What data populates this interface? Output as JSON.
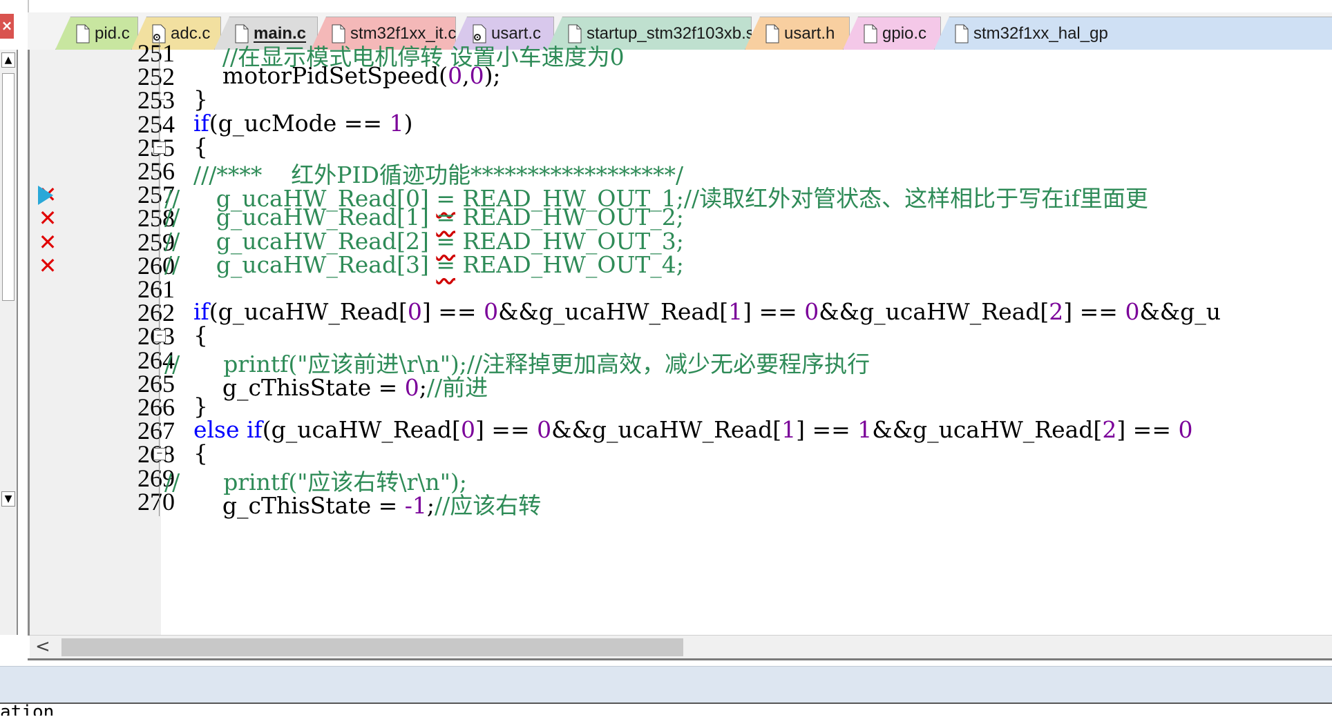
{
  "window": {
    "close_glyph": "×",
    "vscroll_up_glyph": "▲",
    "vscroll_down_glyph": "▼",
    "hscroll_left_glyph": "<"
  },
  "tabs": [
    {
      "label": "pid.c",
      "color": "#c8e6a0",
      "icon": "file-icon",
      "active": false
    },
    {
      "label": "adc.c",
      "color": "#f2e0a0",
      "icon": "file-gear-icon",
      "active": false
    },
    {
      "label": "main.c",
      "color": "#dcdcdc",
      "icon": "file-icon",
      "active": true
    },
    {
      "label": "stm32f1xx_it.c",
      "color": "#f4b8b8",
      "icon": "file-icon",
      "active": false
    },
    {
      "label": "usart.c",
      "color": "#d8c8ec",
      "icon": "file-gear-icon",
      "active": false
    },
    {
      "label": "startup_stm32f103xb.s",
      "color": "#bfe0cf",
      "icon": "file-icon",
      "active": false
    },
    {
      "label": "usart.h",
      "color": "#f8cfa0",
      "icon": "file-icon",
      "active": false
    },
    {
      "label": "gpio.c",
      "color": "#f4c8e8",
      "icon": "file-icon",
      "active": false
    },
    {
      "label": "stm32f1xx_hal_gp",
      "color": "#cfe0f4",
      "icon": "file-icon",
      "active": false
    }
  ],
  "code_lines": [
    {
      "num": "251",
      "marker": "",
      "fold": "line",
      "segments": [
        {
          "t": "        ",
          "c": "c-pl"
        },
        {
          "t": "//在显示模式电机停转 设置小车速度为0",
          "c": "c-com"
        }
      ]
    },
    {
      "num": "252",
      "marker": "",
      "fold": "line",
      "segments": [
        {
          "t": "        motorPidSetSpeed(",
          "c": "c-pl"
        },
        {
          "t": "0",
          "c": "c-num"
        },
        {
          "t": ",",
          "c": "c-pl"
        },
        {
          "t": "0",
          "c": "c-num"
        },
        {
          "t": ");",
          "c": "c-pl"
        }
      ]
    },
    {
      "num": "253",
      "marker": "",
      "fold": "end",
      "segments": [
        {
          "t": "    }",
          "c": "c-pl"
        }
      ]
    },
    {
      "num": "254",
      "marker": "",
      "fold": "line",
      "segments": [
        {
          "t": "    ",
          "c": "c-pl"
        },
        {
          "t": "if",
          "c": "c-kw"
        },
        {
          "t": "(g_ucMode == ",
          "c": "c-pl"
        },
        {
          "t": "1",
          "c": "c-num"
        },
        {
          "t": ")",
          "c": "c-pl"
        }
      ]
    },
    {
      "num": "255",
      "marker": "",
      "fold": "box",
      "segments": [
        {
          "t": "    {",
          "c": "c-pl"
        }
      ]
    },
    {
      "num": "256",
      "marker": "",
      "fold": "line",
      "segments": [
        {
          "t": "    ",
          "c": "c-pl"
        },
        {
          "t": "///****    红外PID循迹功能******************/",
          "c": "c-com"
        }
      ]
    },
    {
      "num": "257",
      "marker": "first",
      "fold": "line",
      "segments": [
        {
          "t": "// ",
          "c": "c-com"
        },
        {
          "t": "    g_ucaHW_Read[0] ",
          "c": "c-com"
        },
        {
          "t": "=",
          "c": "c-com sq"
        },
        {
          "t": " READ_HW_OUT_1;//读取红外对管状态、这样相比于写在if里面更",
          "c": "c-com"
        }
      ]
    },
    {
      "num": "258",
      "marker": "x",
      "fold": "line",
      "segments": [
        {
          "t": "// ",
          "c": "c-com"
        },
        {
          "t": "    g_ucaHW_Read[1] ",
          "c": "c-com"
        },
        {
          "t": "=",
          "c": "c-com sq"
        },
        {
          "t": " READ_HW_OUT_2;",
          "c": "c-com"
        }
      ]
    },
    {
      "num": "259",
      "marker": "x",
      "fold": "line",
      "segments": [
        {
          "t": "// ",
          "c": "c-com"
        },
        {
          "t": "    g_ucaHW_Read[2] ",
          "c": "c-com"
        },
        {
          "t": "=",
          "c": "c-com sq"
        },
        {
          "t": " READ_HW_OUT_3;",
          "c": "c-com"
        }
      ]
    },
    {
      "num": "260",
      "marker": "x",
      "fold": "line",
      "segments": [
        {
          "t": "// ",
          "c": "c-com"
        },
        {
          "t": "    g_ucaHW_Read[3] ",
          "c": "c-com"
        },
        {
          "t": "=",
          "c": "c-com sq"
        },
        {
          "t": " READ_HW_OUT_4;",
          "c": "c-com"
        }
      ]
    },
    {
      "num": "261",
      "marker": "",
      "fold": "line",
      "segments": [
        {
          "t": "",
          "c": "c-pl"
        }
      ]
    },
    {
      "num": "262",
      "marker": "",
      "fold": "line",
      "segments": [
        {
          "t": "    ",
          "c": "c-pl"
        },
        {
          "t": "if",
          "c": "c-kw"
        },
        {
          "t": "(g_ucaHW_Read[",
          "c": "c-pl"
        },
        {
          "t": "0",
          "c": "c-num"
        },
        {
          "t": "] == ",
          "c": "c-pl"
        },
        {
          "t": "0",
          "c": "c-num"
        },
        {
          "t": "&&g_ucaHW_Read[",
          "c": "c-pl"
        },
        {
          "t": "1",
          "c": "c-num"
        },
        {
          "t": "] == ",
          "c": "c-pl"
        },
        {
          "t": "0",
          "c": "c-num"
        },
        {
          "t": "&&g_ucaHW_Read[",
          "c": "c-pl"
        },
        {
          "t": "2",
          "c": "c-num"
        },
        {
          "t": "] == ",
          "c": "c-pl"
        },
        {
          "t": "0",
          "c": "c-num"
        },
        {
          "t": "&&g_u",
          "c": "c-pl"
        }
      ]
    },
    {
      "num": "263",
      "marker": "",
      "fold": "box",
      "segments": [
        {
          "t": "    {",
          "c": "c-pl"
        }
      ]
    },
    {
      "num": "264",
      "marker": "",
      "fold": "line",
      "segments": [
        {
          "t": "//      ",
          "c": "c-com"
        },
        {
          "t": "printf(\"应该前进\\r\\n\");//注释掉更加高效，减少无必要程序执行",
          "c": "c-com"
        }
      ]
    },
    {
      "num": "265",
      "marker": "",
      "fold": "line",
      "segments": [
        {
          "t": "        g_cThisState = ",
          "c": "c-pl"
        },
        {
          "t": "0",
          "c": "c-num"
        },
        {
          "t": ";",
          "c": "c-pl"
        },
        {
          "t": "//前进",
          "c": "c-com"
        }
      ]
    },
    {
      "num": "266",
      "marker": "",
      "fold": "end",
      "segments": [
        {
          "t": "    }",
          "c": "c-pl"
        }
      ]
    },
    {
      "num": "267",
      "marker": "",
      "fold": "line",
      "segments": [
        {
          "t": "    ",
          "c": "c-pl"
        },
        {
          "t": "else if",
          "c": "c-kw"
        },
        {
          "t": "(g_ucaHW_Read[",
          "c": "c-pl"
        },
        {
          "t": "0",
          "c": "c-num"
        },
        {
          "t": "] == ",
          "c": "c-pl"
        },
        {
          "t": "0",
          "c": "c-num"
        },
        {
          "t": "&&g_ucaHW_Read[",
          "c": "c-pl"
        },
        {
          "t": "1",
          "c": "c-num"
        },
        {
          "t": "] == ",
          "c": "c-pl"
        },
        {
          "t": "1",
          "c": "c-num"
        },
        {
          "t": "&&g_ucaHW_Read[",
          "c": "c-pl"
        },
        {
          "t": "2",
          "c": "c-num"
        },
        {
          "t": "] == ",
          "c": "c-pl"
        },
        {
          "t": "0",
          "c": "c-num"
        }
      ]
    },
    {
      "num": "268",
      "marker": "",
      "fold": "box",
      "segments": [
        {
          "t": "    {",
          "c": "c-pl"
        }
      ]
    },
    {
      "num": "269",
      "marker": "",
      "fold": "line",
      "segments": [
        {
          "t": "//      ",
          "c": "c-com"
        },
        {
          "t": "printf(\"应该右转\\r\\n\");",
          "c": "c-com"
        }
      ]
    },
    {
      "num": "270",
      "marker": "",
      "fold": "line",
      "segments": [
        {
          "t": "        g_cThisState = ",
          "c": "c-pl"
        },
        {
          "t": "-1",
          "c": "c-num"
        },
        {
          "t": ";",
          "c": "c-pl"
        },
        {
          "t": "//应该右转",
          "c": "c-com"
        }
      ]
    }
  ],
  "status": {
    "text": "ation"
  },
  "colors": {
    "comment": "#2e8b57",
    "keyword": "#0000ff",
    "number": "#7a0099",
    "error_marker": "#e00000",
    "panel_band": "#dde6f1"
  }
}
